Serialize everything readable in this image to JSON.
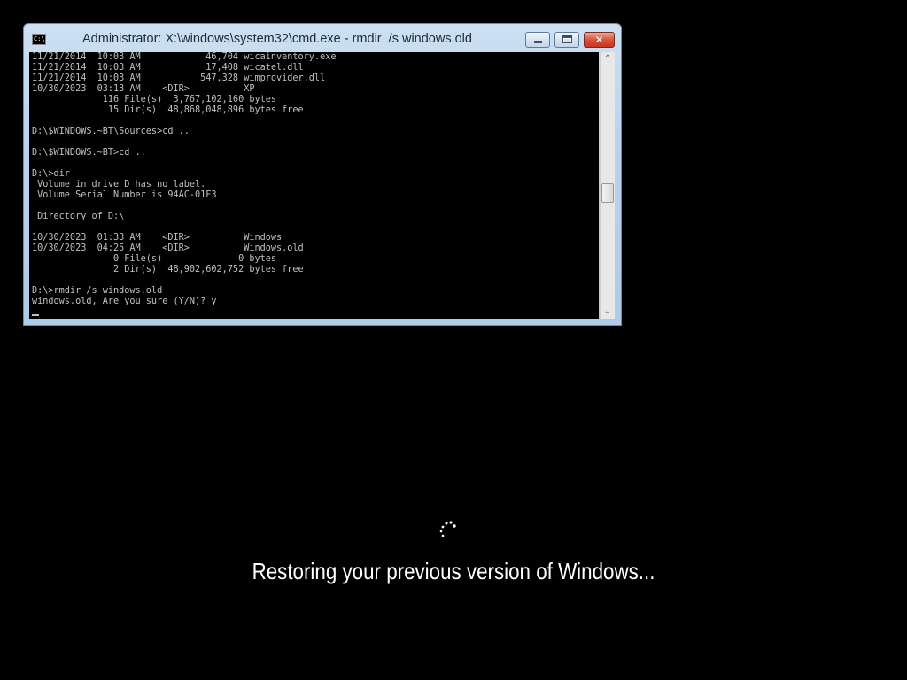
{
  "window": {
    "title": "Administrator: X:\\windows\\system32\\cmd.exe - rmdir  /s windows.old",
    "icon_label": "C:\\.",
    "close_glyph": "✕"
  },
  "console": {
    "lines": [
      "11/21/2014  10:03 AM            46,704 wicainventory.exe",
      "11/21/2014  10:03 AM            17,408 wicatel.dll",
      "11/21/2014  10:03 AM           547,328 wimprovider.dll",
      "10/30/2023  03:13 AM    <DIR>          XP",
      "             116 File(s)  3,767,102,160 bytes",
      "              15 Dir(s)  48,868,048,896 bytes free",
      "",
      "D:\\$WINDOWS.~BT\\Sources>cd ..",
      "",
      "D:\\$WINDOWS.~BT>cd ..",
      "",
      "D:\\>dir",
      " Volume in drive D has no label.",
      " Volume Serial Number is 94AC-01F3",
      "",
      " Directory of D:\\",
      "",
      "10/30/2023  01:33 AM    <DIR>          Windows",
      "10/30/2023  04:25 AM    <DIR>          Windows.old",
      "               0 File(s)              0 bytes",
      "               2 Dir(s)  48,902,602,752 bytes free",
      "",
      "D:\\>rmdir /s windows.old",
      "windows.old, Are you sure (Y/N)? y"
    ]
  },
  "scrollbar": {
    "up_arrow": "⌃",
    "down_arrow": "⌄"
  },
  "overlay": {
    "message": "Restoring your previous version of Windows..."
  },
  "colors": {
    "background": "#000000",
    "console_text": "#c0c0c0",
    "message_text": "#ffffff"
  }
}
